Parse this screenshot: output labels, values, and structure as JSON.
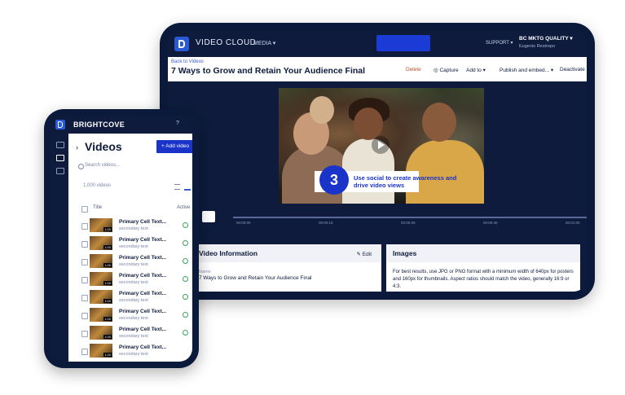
{
  "tablet": {
    "brand": "VIDEO CLOUD",
    "media_menu": "MEDIA",
    "support": "SUPPORT",
    "account_name": "BC MKTG QUALITY",
    "account_user": "Eugenio Restrepo",
    "back_link": "Back to Videos",
    "video_title": "7 Ways to Grow and Retain Your Audience Final",
    "actions": {
      "delete": "Delete",
      "capture": "Capture",
      "add_to": "Add to",
      "publish": "Publish and embed...",
      "deactivate": "Deactivate"
    },
    "overlay_number": "3",
    "overlay_text": "Use social to create awareness and drive video views",
    "timeline_labels": [
      "00:00:00",
      "00:00:15",
      "00:00:30",
      "00:00:45",
      "00:01:00"
    ],
    "video_info": {
      "title": "Video Information",
      "edit": "Edit",
      "name_label": "Name",
      "name_value": "7 Ways to Grow and Retain Your Audience Final"
    },
    "images": {
      "title": "Images",
      "text": "For best results, use JPG or PNG format with a minimum width of 640px for posters and 160px for thumbnails. Aspect ratios should match the video, generally 16:9 or 4:3."
    }
  },
  "phone": {
    "brand": "BRIGHTCOVE",
    "help": "?",
    "page_title": "Videos",
    "add_button": "+ Add video",
    "search_placeholder": "Search videos...",
    "count": "1,000 videos",
    "col_title": "Title",
    "col_active": "Active",
    "rows": [
      {
        "title": "Primary Cell Text...",
        "sub": "secondary text",
        "duration": "1:00"
      },
      {
        "title": "Primary Cell Text...",
        "sub": "secondary text",
        "duration": "1:00"
      },
      {
        "title": "Primary Cell Text...",
        "sub": "secondary text",
        "duration": "1:00"
      },
      {
        "title": "Primary Cell Text...",
        "sub": "secondary text",
        "duration": "1:00"
      },
      {
        "title": "Primary Cell Text...",
        "sub": "secondary text",
        "duration": "1:00"
      },
      {
        "title": "Primary Cell Text...",
        "sub": "secondary text",
        "duration": "1:00"
      },
      {
        "title": "Primary Cell Text...",
        "sub": "secondary text",
        "duration": "1:00"
      },
      {
        "title": "Primary Cell Text...",
        "sub": "secondary text",
        "duration": "1:00"
      }
    ]
  },
  "colors": {
    "navy": "#0e1b3d",
    "accent": "#1a33c9",
    "delete": "#c0502c",
    "active_green": "#3aa35a"
  }
}
